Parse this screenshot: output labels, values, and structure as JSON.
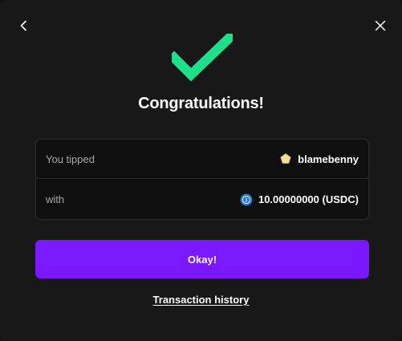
{
  "header": {
    "back_icon": "chevron-left-icon",
    "close_icon": "close-icon"
  },
  "success_icon": "checkmark-icon",
  "title": "Congratulations!",
  "summary": {
    "tipped_label": "You tipped",
    "recipient_icon": "user-avatar-icon",
    "recipient": "blamebenny",
    "with_label": "with",
    "currency_icon": "usdc-coin-icon",
    "amount": "10.00000000 (USDC)"
  },
  "actions": {
    "okay_label": "Okay!",
    "history_link": "Transaction history"
  },
  "colors": {
    "accent": "#7a19ff",
    "success": "#1fe08a",
    "background": "#181818",
    "panel": "#0f0f0f"
  }
}
